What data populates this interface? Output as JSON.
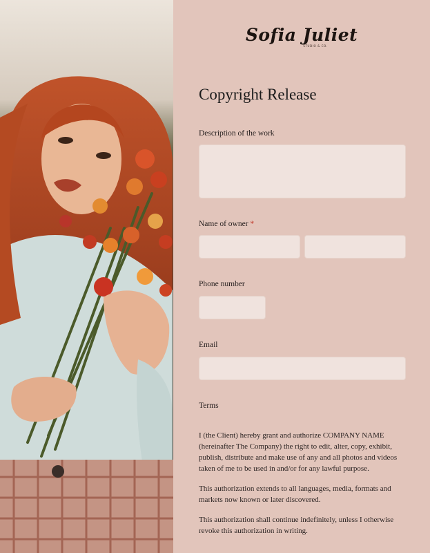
{
  "brand": {
    "name": "Sofia Juliet",
    "tagline": "STUDIO & CO."
  },
  "form": {
    "title": "Copyright Release",
    "description_label": "Description of the work",
    "owner_label": "Name of owner",
    "owner_required_mark": "*",
    "phone_label": "Phone number",
    "email_label": "Email",
    "terms_label": "Terms",
    "terms": [
      "I (the Client) hereby grant and authorize COMPANY NAME (hereinafter The Company) the right to edit, alter, copy, exhibit, publish, distribute and make use of any and all photos and videos taken of me to be used in and/or for any lawful purpose.",
      "This authorization extends to all languages, media, formats and markets now known or later discovered.",
      "This authorization shall continue indefinitely, unless I otherwise revoke this authorization in writing."
    ]
  },
  "colors": {
    "panel_bg": "#e2c5bb",
    "field_bg": "#f0e3de",
    "required": "#c0392b"
  }
}
